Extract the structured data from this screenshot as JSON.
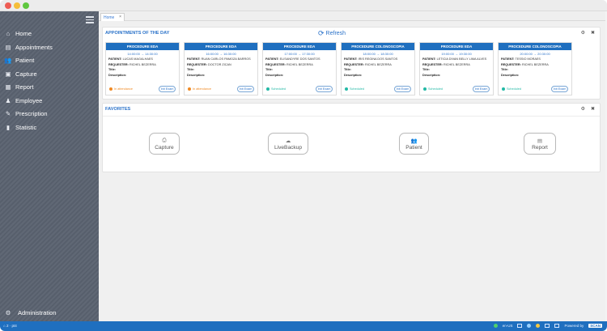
{
  "window": {
    "controls": [
      "close",
      "minimize",
      "maximize"
    ]
  },
  "sidebar": {
    "items": [
      {
        "label": "Home",
        "icon": "home-icon",
        "glyph": "⌂"
      },
      {
        "label": "Appointments",
        "icon": "appointments-icon",
        "glyph": "▤"
      },
      {
        "label": "Patient",
        "icon": "patient-icon",
        "glyph": "👥"
      },
      {
        "label": "Capture",
        "icon": "capture-icon",
        "glyph": "▣"
      },
      {
        "label": "Report",
        "icon": "report-icon",
        "glyph": "▦"
      },
      {
        "label": "Employee",
        "icon": "employee-icon",
        "glyph": "♟"
      },
      {
        "label": "Prescription",
        "icon": "prescription-icon",
        "glyph": "✎"
      },
      {
        "label": "Statistic",
        "icon": "statistic-icon",
        "glyph": "▮"
      }
    ],
    "admin": {
      "label": "Administration",
      "icon": "gear-icon",
      "glyph": "⚙"
    }
  },
  "tabs": [
    {
      "label": "Home",
      "close": "×"
    }
  ],
  "appointments": {
    "title": "APPOINTMENTS OF THE DAY",
    "refresh_label": "Refresh",
    "refresh_glyph": "⟳",
    "actions": {
      "settings_glyph": "⚙",
      "close_glyph": "✖"
    },
    "labels": {
      "patient": "PATIENT:",
      "requester": "REQUESTER:",
      "title": "Title:",
      "description": "Description:"
    },
    "cards": [
      {
        "procedure": "PROCEDURE EDA",
        "time": "14:00:00 → 14:30:00",
        "patient": "LUCAS MAGALHAES",
        "requester": "RICHEL BEZERRA",
        "status": "In attendance",
        "status_color": "#f08a24",
        "button": "Init Exam"
      },
      {
        "procedure": "PROCEDURE EDA",
        "time": "16:00:00 → 16:30:00",
        "patient": "RUAN CARLOS PAMOZA BARROS",
        "requester": "DOCTOR ZICAN",
        "status": "In attendance",
        "status_color": "#f08a24",
        "button": "Init Exam"
      },
      {
        "procedure": "PROCEDURE EDA",
        "time": "17:00:00 → 17:30:00",
        "patient": "ELISANDYRE DOS SANTOS",
        "requester": "RICHEL BEZERRA",
        "status": "Scheduled",
        "status_color": "#22b8a5",
        "button": "Init Exam"
      },
      {
        "procedure": "PROCEDURE COLONOSCOPIA",
        "time": "18:00:00 → 18:30:00",
        "patient": "IRIS REGINA DOS SANTOS",
        "requester": "RICHEL BEZERRA",
        "status": "Scheduled",
        "status_color": "#22b8a5",
        "button": "Init Exam"
      },
      {
        "procedure": "PROCEDURE EDA",
        "time": "19:00:00 → 19:30:00",
        "patient": "LETICIA DIVAN BELLY LIMA ALVES",
        "requester": "RICHEL BEZERRA",
        "status": "Scheduled",
        "status_color": "#22b8a5",
        "button": "Init Exam"
      },
      {
        "procedure": "PROCEDURE COLONOSCOPIA",
        "time": "20:00:00 → 20:30:00",
        "patient": "TESSIO MORAES",
        "requester": "RICHEL BEZERRA",
        "status": "Scheduled",
        "status_color": "#22b8a5",
        "button": "Init Exam"
      }
    ]
  },
  "favorites": {
    "title": "FAVORITES",
    "actions": {
      "settings_glyph": "⚙",
      "close_glyph": "✖"
    },
    "items": [
      {
        "label": "Capture",
        "icon": "camera-icon",
        "glyph": "⎙"
      },
      {
        "label": "LiveBackup",
        "icon": "cloud-upload-icon",
        "glyph": "☁"
      },
      {
        "label": "Patient",
        "icon": "patient-icon",
        "glyph": "👥"
      },
      {
        "label": "Report",
        "icon": "report-icon",
        "glyph": "▤"
      }
    ]
  },
  "statusbar": {
    "left_text": "⌂ 2 · pt4",
    "right_text": "en-US",
    "powered_by": "Powered by",
    "brand": "SCAN"
  },
  "colors": {
    "accent": "#1f6fbf",
    "sidebar": "#5a6270",
    "scheduled": "#22b8a5",
    "in_attendance": "#f08a24"
  }
}
